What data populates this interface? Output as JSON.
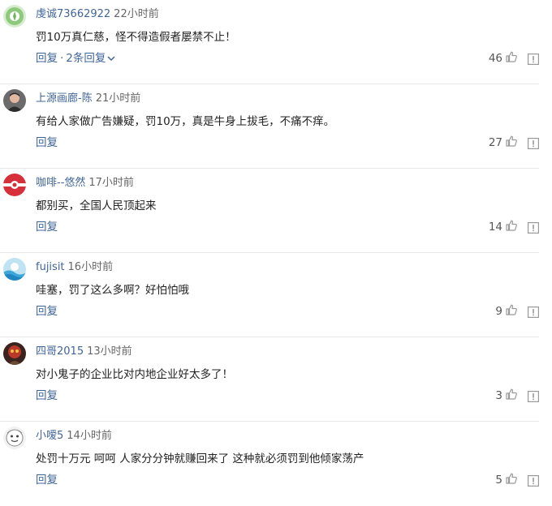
{
  "comments": [
    {
      "user": "虔诚73662922",
      "time": "22小时前",
      "text": "罚10万真仁慈，怪不得造假者屡禁不止！",
      "reply_label": "回复",
      "separator": "·",
      "replies_label": "2条回复",
      "likes": "46",
      "avatar": "green-circle-avatar"
    },
    {
      "user": "上源画廊-陈",
      "time": "21小时前",
      "text": "有给人家做广告嫌疑，罚10万，真是牛身上拔毛，不痛不痒。",
      "reply_label": "回复",
      "likes": "27",
      "avatar": "man-photo-avatar"
    },
    {
      "user": "咖啡--悠然",
      "time": "17小时前",
      "text": "都别买，全国人民顶起来",
      "reply_label": "回复",
      "likes": "14",
      "avatar": "red-circle-avatar"
    },
    {
      "user": "fujisit",
      "time": "16小时前",
      "text": "哇塞，罚了这么多啊？好怕怕哦",
      "reply_label": "回复",
      "likes": "9",
      "avatar": "blue-wave-avatar"
    },
    {
      "user": "四哥2015",
      "time": "13小时前",
      "text": "对小鬼子的企业比对内地企业好太多了！",
      "reply_label": "回复",
      "likes": "3",
      "avatar": "red-dark-avatar"
    },
    {
      "user": "小嗳5",
      "time": "14小时前",
      "text": "处罚十万元 呵呵 人家分分钟就赚回来了 这种就必须罚到他倾家荡产",
      "reply_label": "回复",
      "likes": "5",
      "avatar": "cartoon-avatar"
    }
  ],
  "colors": {
    "username": "#406599",
    "link": "#406599",
    "icon_gray": "#999999",
    "divider": "#e8e8e8"
  }
}
